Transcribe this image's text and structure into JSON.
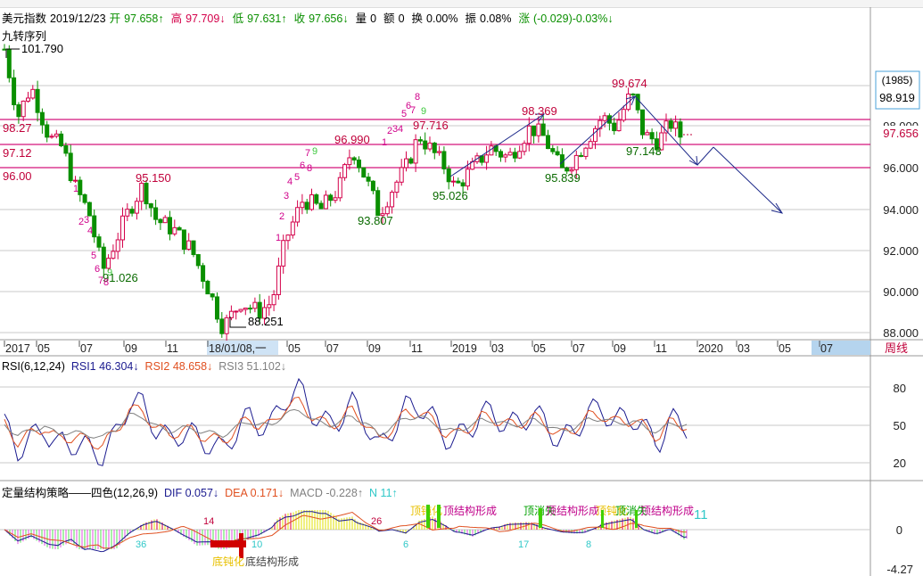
{
  "header": {
    "name": "美元指数",
    "date": "2019/12/23",
    "open_label": "开",
    "open": "97.658↑",
    "high_label": "高",
    "high": "97.709↓",
    "low_label": "低",
    "low": "97.631↑",
    "close_label": "收",
    "close": "97.656↓",
    "vol_label": "量",
    "vol": "0",
    "amt_label": "额",
    "amt": "0",
    "turnover_label": "换",
    "turnover": "0.00%",
    "amp_label": "振",
    "amp": "0.08%",
    "chg_label": "涨",
    "chg": "(-0.029)-0.03%↓"
  },
  "indicator_name": "九转序列",
  "main": {
    "y_ticks": [
      "98.000",
      "96.000",
      "94.000",
      "92.000",
      "90.000",
      "88.000"
    ],
    "left_levels": [
      "98.27",
      "97.12",
      "96.00"
    ],
    "annotations": {
      "high1": "101.790",
      "low1": "91.026",
      "peak1": "95.150",
      "low2": "88.251",
      "peak2": "96.990",
      "low3": "93.807",
      "peak3": "97.716",
      "low4": "95.026",
      "peak4": "98.369",
      "low5": "95.839",
      "peak5": "99.674",
      "low6": "97.143"
    },
    "right_box_top": "(1985)",
    "right_box_value": "98.919",
    "last_price": "97.656"
  },
  "x_axis": {
    "labels": [
      "2017",
      "05",
      "07",
      "09",
      "11",
      "18/01/08,一",
      "05",
      "07",
      "09",
      "11",
      "2019",
      "03",
      "05",
      "07",
      "09",
      "11",
      "2020",
      "03",
      "05",
      "07"
    ],
    "period": "周线"
  },
  "rsi": {
    "title": "RSI(6,12,24)",
    "rsi1_label": "RSI1",
    "rsi1": "46.304↓",
    "rsi2_label": "RSI2",
    "rsi2": "48.658↓",
    "rsi3_label": "RSI3",
    "rsi3": "51.102↓",
    "y_ticks": [
      "80",
      "50",
      "20"
    ]
  },
  "macd": {
    "title": "定量结构策略——四色(12,26,9)",
    "dif_label": "DIF",
    "dif": "0.057↓",
    "dea_label": "DEA",
    "dea": "0.171↓",
    "macd_label": "MACD",
    "macd": "-0.228↑",
    "n_label": "N",
    "n": "11↑",
    "y_ticks": [
      "0",
      "-4.27"
    ],
    "texts": {
      "bottom_struct": "底结构形成",
      "bottom_struct_faded": "底钝化",
      "top_struct": "顶结构形成",
      "top_struct_faded": "顶钝化",
      "top_cancel": "顶消失"
    },
    "counts": [
      "36",
      "14",
      "10",
      "26",
      "6",
      "17",
      "8",
      "11"
    ]
  },
  "colors": {
    "up": "#d4004a",
    "down": "#0a8f00",
    "magenta_line": "#d4147c",
    "rsi1": "#1b1b8f",
    "rsi2": "#e05020",
    "rsi3": "#808080",
    "highlight_axis": "#b5d4ee"
  }
}
